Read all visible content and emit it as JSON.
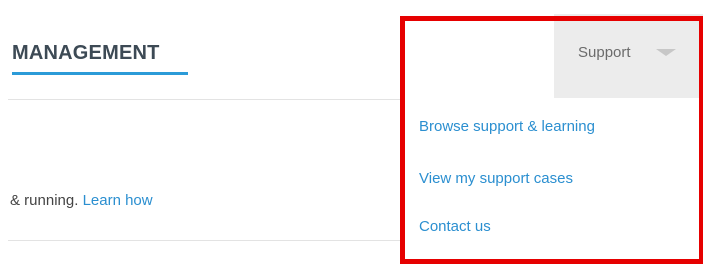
{
  "page": {
    "heading": "MANAGEMENT",
    "body_text": "& running.",
    "learn_link": "Learn how"
  },
  "support_menu": {
    "label": "Support",
    "items": [
      {
        "label": "Browse support & learning"
      },
      {
        "label": "View my support cases"
      },
      {
        "label": "Contact us"
      }
    ]
  },
  "colors": {
    "accent": "#2b9bd8",
    "link": "#2b8fd0",
    "highlight": "#e60000",
    "tab_background": "#ececec"
  }
}
